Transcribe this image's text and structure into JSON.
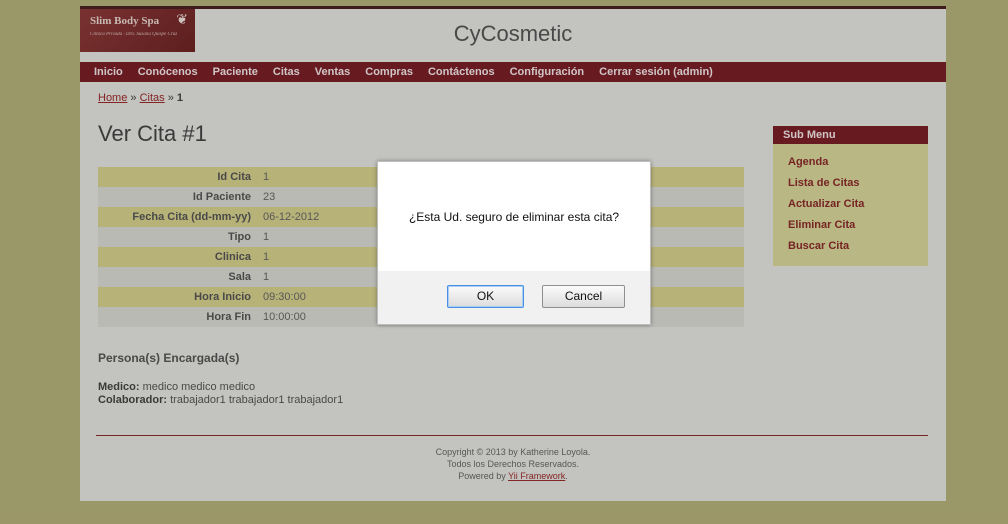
{
  "header": {
    "logo_text": "Slim Body Spa",
    "logo_sub": "Clínica Privada · Dra. Susana Quispe Cruz",
    "logo_icon": "leaf-icon",
    "site_title": "CyCosmetic"
  },
  "nav": [
    "Inicio",
    "Conócenos",
    "Paciente",
    "Citas",
    "Ventas",
    "Compras",
    "Contáctenos",
    "Configuración",
    "Cerrar sesión (admin)"
  ],
  "breadcrumb": {
    "home": "Home",
    "sep1": "»",
    "citas": "Citas",
    "sep2": "»",
    "current": "1"
  },
  "page_title": "Ver Cita #1",
  "details": [
    {
      "label": "Id Cita",
      "value": "1"
    },
    {
      "label": "Id Paciente",
      "value": "23"
    },
    {
      "label": "Fecha Cita (dd-mm-yy)",
      "value": "06-12-2012"
    },
    {
      "label": "Tipo",
      "value": "1"
    },
    {
      "label": "Clinica",
      "value": "1"
    },
    {
      "label": "Sala",
      "value": "1"
    },
    {
      "label": "Hora Inicio",
      "value": "09:30:00"
    },
    {
      "label": "Hora Fin",
      "value": "10:00:00"
    }
  ],
  "persona_title": "Persona(s) Encargada(s)",
  "medico": {
    "label": "Medico:",
    "value": "medico medico medico"
  },
  "colaborador": {
    "label": "Colaborador:",
    "value": "trabajador1 trabajador1 trabajador1"
  },
  "sub_menu": {
    "title": "Sub Menu",
    "items": [
      "Agenda",
      "Lista de Citas",
      "Actualizar Cita",
      "Eliminar Cita",
      "Buscar Cita"
    ]
  },
  "footer": {
    "line1": "Copyright © 2013 by Katherine Loyola.",
    "line2": "Todos los Derechos Reservados.",
    "powered": "Powered by",
    "powered_link": "Yii Framework",
    "powered_end": "."
  },
  "dialog": {
    "message": "¿Esta Ud. seguro de eliminar esta cita?",
    "ok": "OK",
    "cancel": "Cancel"
  },
  "colors": {
    "nav_bg": "#7a1f27",
    "page_bg": "#b4b07a",
    "accent_row": "#d6d08c"
  }
}
